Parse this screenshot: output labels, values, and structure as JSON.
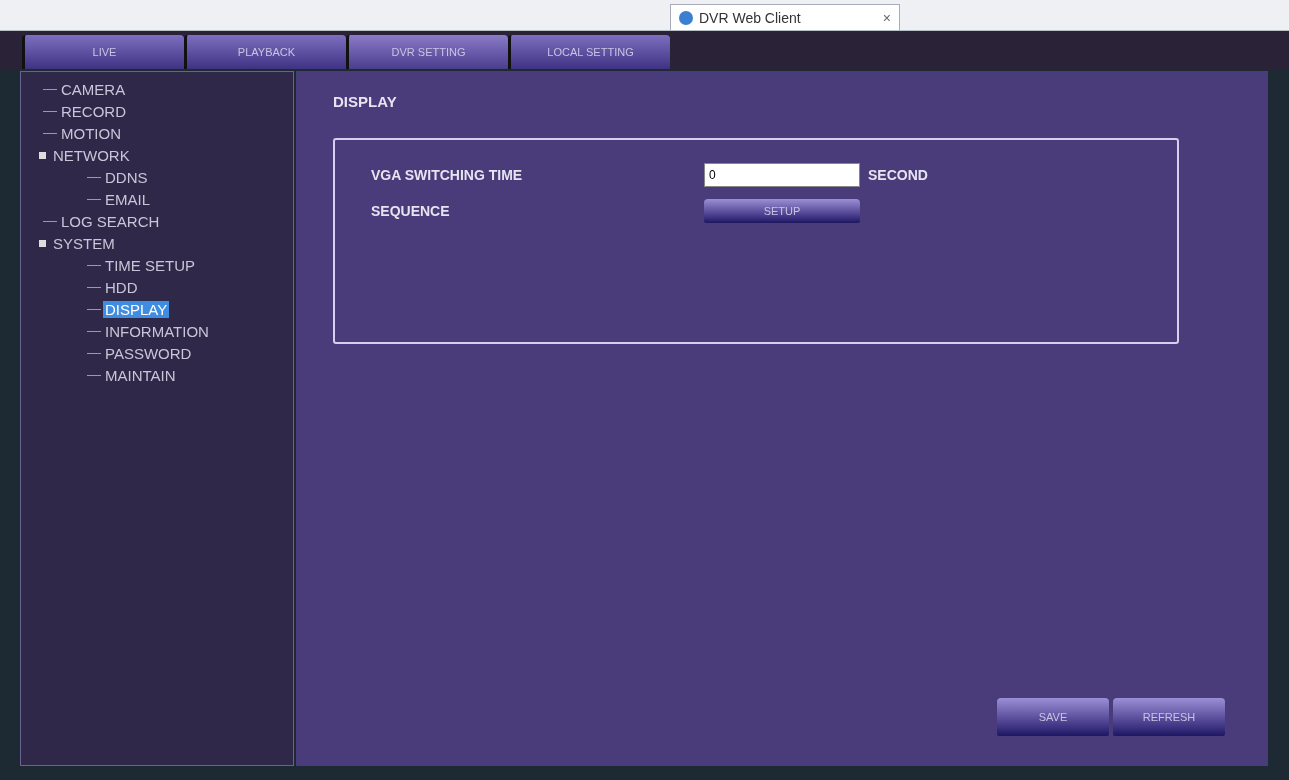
{
  "browser": {
    "tab_title": "DVR Web Client",
    "tab_close": "×"
  },
  "tabs": [
    {
      "label": "LIVE",
      "selected": false
    },
    {
      "label": "PLAYBACK",
      "selected": false
    },
    {
      "label": "DVR SETTING",
      "selected": true
    },
    {
      "label": "LOCAL SETTING",
      "selected": false
    }
  ],
  "sidebar": {
    "items": [
      {
        "label": "CAMERA",
        "selected": false
      },
      {
        "label": "RECORD",
        "selected": false
      },
      {
        "label": "MOTION",
        "selected": false
      },
      {
        "label": "NETWORK",
        "selected": false,
        "expanded": true,
        "children": [
          {
            "label": "DDNS",
            "selected": false
          },
          {
            "label": "EMAIL",
            "selected": false
          }
        ]
      },
      {
        "label": "LOG SEARCH",
        "selected": false
      },
      {
        "label": "SYSTEM",
        "selected": false,
        "expanded": true,
        "children": [
          {
            "label": "TIME SETUP",
            "selected": false
          },
          {
            "label": "HDD",
            "selected": false
          },
          {
            "label": "DISPLAY",
            "selected": true
          },
          {
            "label": "INFORMATION",
            "selected": false
          },
          {
            "label": "PASSWORD",
            "selected": false
          },
          {
            "label": "MAINTAIN",
            "selected": false
          }
        ]
      }
    ]
  },
  "page_title": "DISPLAY",
  "settings": [
    {
      "kind": "input",
      "label": "VGA SWITCHING TIME",
      "value": "0",
      "unit": "SECOND"
    },
    {
      "kind": "button",
      "label": "SEQUENCE",
      "button": "SETUP"
    }
  ],
  "buttons": [
    "SAVE",
    "REFRESH"
  ]
}
